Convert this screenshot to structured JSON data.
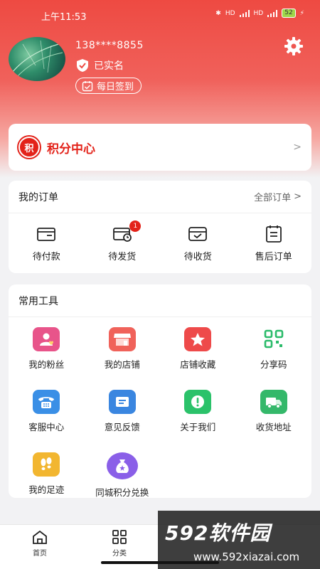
{
  "status_bar": {
    "time": "上午11:53",
    "battery": "52"
  },
  "profile": {
    "phone": "138****8855",
    "verified_label": "已实名",
    "checkin_label": "每日签到"
  },
  "points": {
    "badge": "积",
    "title": "积分中心"
  },
  "orders": {
    "title": "我的订单",
    "all_label": "全部订单",
    "items": [
      {
        "label": "待付款",
        "icon": "wallet-icon"
      },
      {
        "label": "待发货",
        "icon": "pending-shipment-icon",
        "badge": "1"
      },
      {
        "label": "待收货",
        "icon": "receive-box-icon"
      },
      {
        "label": "售后订单",
        "icon": "after-sale-icon"
      }
    ]
  },
  "tools": {
    "title": "常用工具",
    "items": [
      {
        "label": "我的粉丝",
        "icon": "fans-icon",
        "color": "#e8548a"
      },
      {
        "label": "我的店铺",
        "icon": "store-icon",
        "color": "#f0625a"
      },
      {
        "label": "店铺收藏",
        "icon": "favorite-store-icon",
        "color": "#ee4a4a"
      },
      {
        "label": "分享码",
        "icon": "qr-code-icon",
        "color": "#2bbb6a"
      },
      {
        "label": "客服中心",
        "icon": "phone-icon",
        "color": "#3a8fe6"
      },
      {
        "label": "意见反馈",
        "icon": "feedback-icon",
        "color": "#3a86e0"
      },
      {
        "label": "关于我们",
        "icon": "info-icon",
        "color": "#2bc26a"
      },
      {
        "label": "收货地址",
        "icon": "delivery-truck-icon",
        "color": "#34b86a"
      },
      {
        "label": "我的足迹",
        "icon": "footprint-icon",
        "color": "#f2b630"
      },
      {
        "label": "同城积分兑换",
        "icon": "money-bag-icon",
        "color": "#8a5fe8"
      }
    ]
  },
  "tabbar": [
    {
      "label": "首页",
      "icon": "home-icon"
    },
    {
      "label": "分类",
      "icon": "category-icon"
    }
  ],
  "watermark": {
    "brand": "592软件园",
    "url": "www.592xiazai.com"
  }
}
